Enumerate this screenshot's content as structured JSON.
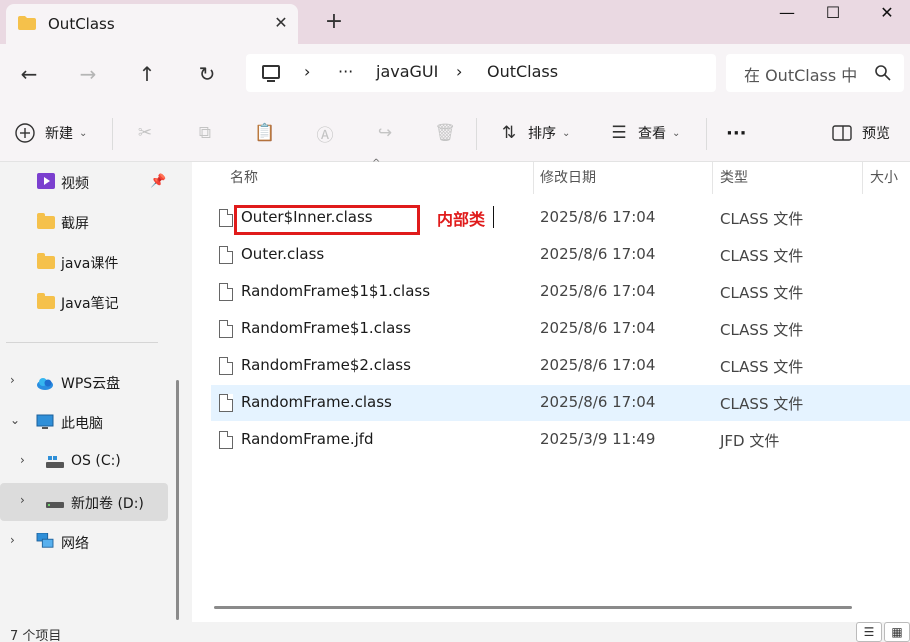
{
  "tab": {
    "title": "OutClass",
    "close_glyph": "✕",
    "new_tab_glyph": "+"
  },
  "window": {
    "minimize": "—",
    "maximize": "☐",
    "close": "✕"
  },
  "nav": {
    "back": "←",
    "forward": "→",
    "up": "↑",
    "refresh": "↻"
  },
  "address": {
    "separator": "›",
    "ellipsis": "···",
    "crumbs": [
      "javaGUI",
      "OutClass"
    ]
  },
  "search": {
    "placeholder": "在 OutClass 中"
  },
  "toolbar": {
    "new_label": "新建",
    "sort_label": "排序",
    "view_label": "查看",
    "more": "···",
    "preview_label": "预览"
  },
  "sidebar": {
    "quick_items": [
      {
        "label": "视频",
        "icon": "video-icon"
      },
      {
        "label": "截屏",
        "icon": "folder-icon"
      },
      {
        "label": "java课件",
        "icon": "folder-icon"
      },
      {
        "label": "Java笔记",
        "icon": "folder-icon"
      }
    ],
    "tree": [
      {
        "label": "WPS云盘",
        "icon": "cloud-icon",
        "chev": "›"
      },
      {
        "label": "此电脑",
        "icon": "pc-icon",
        "chev": "⌄"
      },
      {
        "label": "OS (C:)",
        "icon": "drive-icon",
        "chev": "›"
      },
      {
        "label": "新加卷 (D:)",
        "icon": "drive-icon",
        "chev": "›"
      },
      {
        "label": "网络",
        "icon": "network-icon",
        "chev": "›"
      }
    ]
  },
  "columns": {
    "name": "名称",
    "modified": "修改日期",
    "type": "类型",
    "size": "大小"
  },
  "files": [
    {
      "name": "Outer$Inner.class",
      "modified": "2025/8/6 17:04",
      "type": "CLASS 文件"
    },
    {
      "name": "Outer.class",
      "modified": "2025/8/6 17:04",
      "type": "CLASS 文件"
    },
    {
      "name": "RandomFrame$1$1.class",
      "modified": "2025/8/6 17:04",
      "type": "CLASS 文件"
    },
    {
      "name": "RandomFrame$1.class",
      "modified": "2025/8/6 17:04",
      "type": "CLASS 文件"
    },
    {
      "name": "RandomFrame$2.class",
      "modified": "2025/8/6 17:04",
      "type": "CLASS 文件"
    },
    {
      "name": "RandomFrame.class",
      "modified": "2025/8/6 17:04",
      "type": "CLASS 文件"
    },
    {
      "name": "RandomFrame.jfd",
      "modified": "2025/3/9 11:49",
      "type": "JFD 文件"
    }
  ],
  "annotation": {
    "text": "内部类",
    "color": "#e01b1b"
  },
  "status": {
    "count": "7 个项目"
  },
  "colors": {
    "accent": "#0067c0",
    "selection": "#e5f3ff",
    "titlebar": "#ead9e2"
  }
}
